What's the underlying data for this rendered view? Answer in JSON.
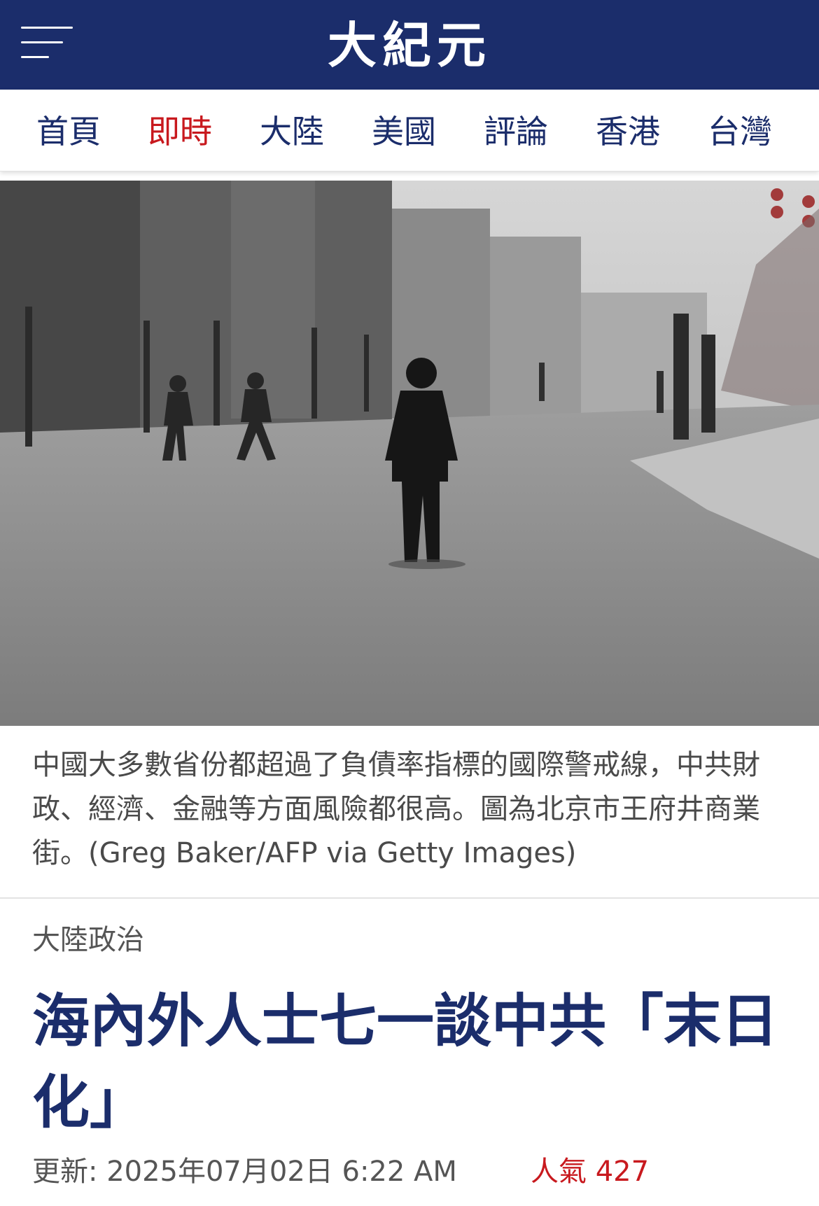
{
  "header": {
    "logo": "大紀元",
    "menu_icon": "hamburger-menu-icon"
  },
  "nav": {
    "items": [
      {
        "label": "首頁",
        "active": false
      },
      {
        "label": "即時",
        "active": true
      },
      {
        "label": "大陸",
        "active": false
      },
      {
        "label": "美國",
        "active": false
      },
      {
        "label": "評論",
        "active": false
      },
      {
        "label": "香港",
        "active": false
      },
      {
        "label": "台灣",
        "active": false
      }
    ]
  },
  "article": {
    "caption": "中國大多數省份都超過了負債率指標的國際警戒線，中共財政、經濟、金融等方面風險都很高。圖為北京市王府井商業街。(Greg Baker/AFP via Getty Images)",
    "category": "大陸政治",
    "title": "海內外人士七一談中共「末日化」",
    "updated": "更新: 2025年07月02日 6:22 AM",
    "popularity": "人氣 427"
  },
  "colors": {
    "brand_navy": "#1b2d6b",
    "accent_red": "#c8191e",
    "caption_gray": "#4a4a4a"
  }
}
